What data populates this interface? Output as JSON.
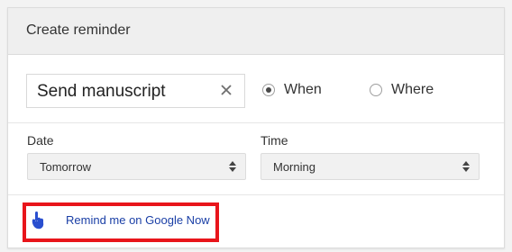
{
  "header": {
    "title": "Create reminder"
  },
  "reminder": {
    "name_value": "Send manuscript",
    "trigger_options": [
      {
        "label": "When",
        "selected": true
      },
      {
        "label": "Where",
        "selected": false
      }
    ]
  },
  "date": {
    "label": "Date",
    "selected": "Tomorrow"
  },
  "time": {
    "label": "Time",
    "selected": "Morning"
  },
  "google_now": {
    "label": "Remind me on Google Now"
  },
  "colors": {
    "link": "#1a3fa6",
    "highlight_border": "#e8151b",
    "header_bg": "#efefef",
    "icon_blue": "#2a4fcf"
  },
  "icons": {
    "clear": "close-icon",
    "google_now": "google-now-hand-icon",
    "select_arrows": "sort-arrows-icon"
  }
}
